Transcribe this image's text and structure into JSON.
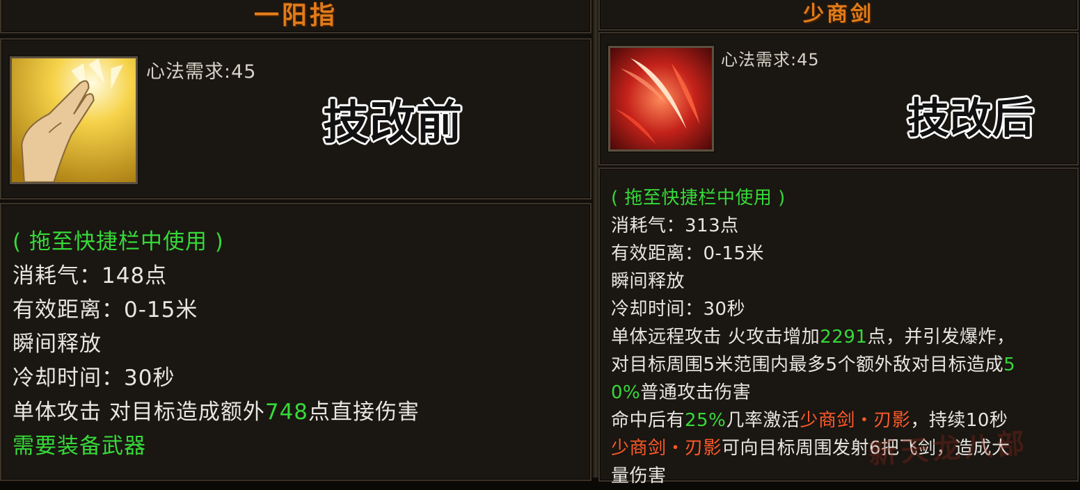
{
  "left": {
    "title": "一阳指",
    "requirement": "心法需求:45",
    "tag": "技改前",
    "drag_hint": "( 拖至快捷栏中使用 )",
    "cost": "消耗气：148点",
    "range": "有效距离：0-15米",
    "cast": "瞬间释放",
    "cooldown": "冷却时间：30秒",
    "effect_prefix": "单体攻击 对目标造成额外",
    "effect_value": "748",
    "effect_suffix": "点直接伤害",
    "weapon_req": "需要装备武器"
  },
  "right": {
    "title": "少商剑",
    "requirement": "心法需求:45",
    "tag": "技改后",
    "drag_hint": "( 拖至快捷栏中使用 )",
    "cost": "消耗气：313点",
    "range": "有效距离：0-15米",
    "cast": "瞬间释放",
    "cooldown": "冷却时间：30秒",
    "effect1_prefix": "单体远程攻击 火攻击增加",
    "effect1_value": "2291",
    "effect1_suffix": "点，并引发爆炸，",
    "effect2_prefix": "对目标周围5米范围内最多5个额外敌对目标造成",
    "effect2_value_a": "5",
    "effect3_value_b": "0%",
    "effect3_suffix": "普通攻击伤害",
    "effect4_prefix": "命中后有",
    "effect4_value": "25%",
    "effect4_mid": "几率激活",
    "effect4_skill": "少商剑・刃影",
    "effect4_suffix": "，持续10秒",
    "effect5_skill": "少商剑・刃影",
    "effect5_suffix": "可向目标周围发射6把飞剑，造成大",
    "effect6": "量伤害",
    "watermark": "新天龙八部"
  },
  "icons": {
    "left_icon": "finger-strike-skill-icon",
    "right_icon": "sword-slash-skill-icon"
  },
  "colors": {
    "title": "#e07b1a",
    "hint_green": "#36d93a",
    "skill_red": "#ff5a2a",
    "text": "#e8e6e1"
  }
}
